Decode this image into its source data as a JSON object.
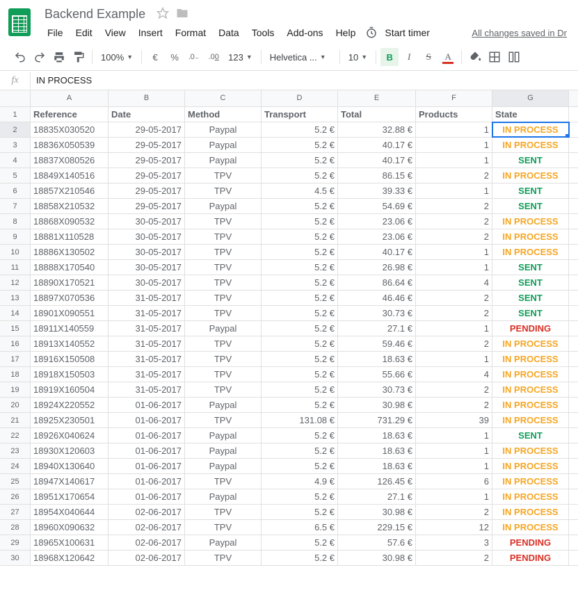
{
  "doc": {
    "title": "Backend Example",
    "saved_status": "All changes saved in Dr"
  },
  "menu": {
    "file": "File",
    "edit": "Edit",
    "view": "View",
    "insert": "Insert",
    "format": "Format",
    "data": "Data",
    "tools": "Tools",
    "addons": "Add-ons",
    "help": "Help",
    "start_timer": "Start timer"
  },
  "toolbar": {
    "zoom": "100%",
    "currency": "€",
    "percent": "%",
    "dec_dec": ".0",
    "inc_dec": ".00",
    "format_more": "123",
    "font": "Helvetica ...",
    "font_size": "10",
    "bold": "B",
    "italic": "I",
    "strike": "S",
    "text_color": "A"
  },
  "formula_bar": {
    "fx": "fx",
    "value": "IN PROCESS"
  },
  "columns": [
    "A",
    "B",
    "C",
    "D",
    "E",
    "F",
    "G"
  ],
  "headers": {
    "a": "Reference",
    "b": "Date",
    "c": "Method",
    "d": "Transport",
    "e": "Total",
    "f": "Products",
    "g": "State"
  },
  "selected_cell": {
    "row": 2,
    "col": "G"
  },
  "state_styles": {
    "IN PROCESS": "st-inprocess",
    "SENT": "st-sent",
    "PENDING": "st-pending"
  },
  "rows": [
    {
      "ref": "18835X030520",
      "date": "29-05-2017",
      "method": "Paypal",
      "transport": "5.2 €",
      "total": "32.88 €",
      "products": "1",
      "state": "IN PROCESS"
    },
    {
      "ref": "18836X050539",
      "date": "29-05-2017",
      "method": "Paypal",
      "transport": "5.2 €",
      "total": "40.17 €",
      "products": "1",
      "state": "IN PROCESS"
    },
    {
      "ref": "18837X080526",
      "date": "29-05-2017",
      "method": "Paypal",
      "transport": "5.2 €",
      "total": "40.17 €",
      "products": "1",
      "state": "SENT"
    },
    {
      "ref": "18849X140516",
      "date": "29-05-2017",
      "method": "TPV",
      "transport": "5.2 €",
      "total": "86.15 €",
      "products": "2",
      "state": "IN PROCESS"
    },
    {
      "ref": "18857X210546",
      "date": "29-05-2017",
      "method": "TPV",
      "transport": "4.5 €",
      "total": "39.33 €",
      "products": "1",
      "state": "SENT"
    },
    {
      "ref": "18858X210532",
      "date": "29-05-2017",
      "method": "Paypal",
      "transport": "5.2 €",
      "total": "54.69 €",
      "products": "2",
      "state": "SENT"
    },
    {
      "ref": "18868X090532",
      "date": "30-05-2017",
      "method": "TPV",
      "transport": "5.2 €",
      "total": "23.06 €",
      "products": "2",
      "state": "IN PROCESS"
    },
    {
      "ref": "18881X110528",
      "date": "30-05-2017",
      "method": "TPV",
      "transport": "5.2 €",
      "total": "23.06 €",
      "products": "2",
      "state": "IN PROCESS"
    },
    {
      "ref": "18886X130502",
      "date": "30-05-2017",
      "method": "TPV",
      "transport": "5.2 €",
      "total": "40.17 €",
      "products": "1",
      "state": "IN PROCESS"
    },
    {
      "ref": "18888X170540",
      "date": "30-05-2017",
      "method": "TPV",
      "transport": "5.2 €",
      "total": "26.98 €",
      "products": "1",
      "state": "SENT"
    },
    {
      "ref": "18890X170521",
      "date": "30-05-2017",
      "method": "TPV",
      "transport": "5.2 €",
      "total": "86.64 €",
      "products": "4",
      "state": "SENT"
    },
    {
      "ref": "18897X070536",
      "date": "31-05-2017",
      "method": "TPV",
      "transport": "5.2 €",
      "total": "46.46 €",
      "products": "2",
      "state": "SENT"
    },
    {
      "ref": "18901X090551",
      "date": "31-05-2017",
      "method": "TPV",
      "transport": "5.2 €",
      "total": "30.73 €",
      "products": "2",
      "state": "SENT"
    },
    {
      "ref": "18911X140559",
      "date": "31-05-2017",
      "method": "Paypal",
      "transport": "5.2 €",
      "total": "27.1 €",
      "products": "1",
      "state": "PENDING"
    },
    {
      "ref": "18913X140552",
      "date": "31-05-2017",
      "method": "TPV",
      "transport": "5.2 €",
      "total": "59.46 €",
      "products": "2",
      "state": "IN PROCESS"
    },
    {
      "ref": "18916X150508",
      "date": "31-05-2017",
      "method": "TPV",
      "transport": "5.2 €",
      "total": "18.63 €",
      "products": "1",
      "state": "IN PROCESS"
    },
    {
      "ref": "18918X150503",
      "date": "31-05-2017",
      "method": "TPV",
      "transport": "5.2 €",
      "total": "55.66 €",
      "products": "4",
      "state": "IN PROCESS"
    },
    {
      "ref": "18919X160504",
      "date": "31-05-2017",
      "method": "TPV",
      "transport": "5.2 €",
      "total": "30.73 €",
      "products": "2",
      "state": "IN PROCESS"
    },
    {
      "ref": "18924X220552",
      "date": "01-06-2017",
      "method": "Paypal",
      "transport": "5.2 €",
      "total": "30.98 €",
      "products": "2",
      "state": "IN PROCESS"
    },
    {
      "ref": "18925X230501",
      "date": "01-06-2017",
      "method": "TPV",
      "transport": "131.08 €",
      "total": "731.29 €",
      "products": "39",
      "state": "IN PROCESS"
    },
    {
      "ref": "18926X040624",
      "date": "01-06-2017",
      "method": "Paypal",
      "transport": "5.2 €",
      "total": "18.63 €",
      "products": "1",
      "state": "SENT"
    },
    {
      "ref": "18930X120603",
      "date": "01-06-2017",
      "method": "Paypal",
      "transport": "5.2 €",
      "total": "18.63 €",
      "products": "1",
      "state": "IN PROCESS"
    },
    {
      "ref": "18940X130640",
      "date": "01-06-2017",
      "method": "Paypal",
      "transport": "5.2 €",
      "total": "18.63 €",
      "products": "1",
      "state": "IN PROCESS"
    },
    {
      "ref": "18947X140617",
      "date": "01-06-2017",
      "method": "TPV",
      "transport": "4.9 €",
      "total": "126.45 €",
      "products": "6",
      "state": "IN PROCESS"
    },
    {
      "ref": "18951X170654",
      "date": "01-06-2017",
      "method": "Paypal",
      "transport": "5.2 €",
      "total": "27.1 €",
      "products": "1",
      "state": "IN PROCESS"
    },
    {
      "ref": "18954X040644",
      "date": "02-06-2017",
      "method": "TPV",
      "transport": "5.2 €",
      "total": "30.98 €",
      "products": "2",
      "state": "IN PROCESS"
    },
    {
      "ref": "18960X090632",
      "date": "02-06-2017",
      "method": "TPV",
      "transport": "6.5 €",
      "total": "229.15 €",
      "products": "12",
      "state": "IN PROCESS"
    },
    {
      "ref": "18965X100631",
      "date": "02-06-2017",
      "method": "Paypal",
      "transport": "5.2 €",
      "total": "57.6 €",
      "products": "3",
      "state": "PENDING"
    },
    {
      "ref": "18968X120642",
      "date": "02-06-2017",
      "method": "TPV",
      "transport": "5.2 €",
      "total": "30.98 €",
      "products": "2",
      "state": "PENDING"
    }
  ]
}
